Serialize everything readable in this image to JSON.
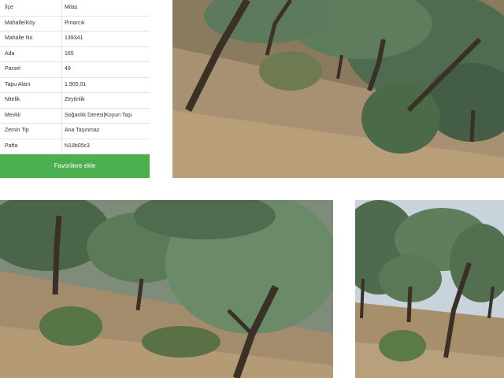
{
  "parcel_info": {
    "rows": [
      {
        "label": "İlçe",
        "value": "Milas"
      },
      {
        "label": "Mahalle/Köy",
        "value": "Pınarcık"
      },
      {
        "label": "Mahalle No",
        "value": "139341"
      },
      {
        "label": "Ada",
        "value": "165"
      },
      {
        "label": "Parsel",
        "value": "49"
      },
      {
        "label": "Tapu Alanı",
        "value": "1.905,01"
      },
      {
        "label": "Nitelik",
        "value": "Zeytinlik"
      },
      {
        "label": "Mevkii",
        "value": "Soğanlık Deresi|Koyun Taşı"
      },
      {
        "label": "Zemin Tip",
        "value": "Ana Taşınmaz"
      },
      {
        "label": "Pafta",
        "value": "N18b05c3"
      }
    ],
    "button_label": "Favorilere ekle"
  },
  "colors": {
    "button": "#4caf50",
    "foliage": "#5d7a5c",
    "ground": "#a08a6a"
  }
}
